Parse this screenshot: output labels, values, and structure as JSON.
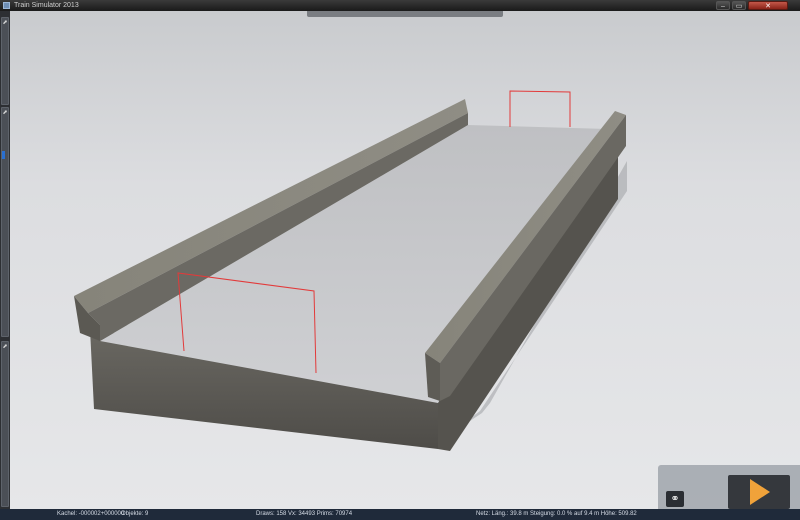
{
  "window": {
    "title": "Train Simulator 2013",
    "minimize_glyph": "–",
    "maximize_glyph": "▭",
    "close_glyph": "✕"
  },
  "left_panel": {
    "pin_glyph": "⬈"
  },
  "corner_widget": {
    "link_icon": "link-icon",
    "link_glyph": "⚭",
    "play_icon": "play-icon",
    "accent_color": "#f0a23a"
  },
  "status": {
    "kachel": "Kachel: -000002+000000",
    "objekte": "Objekte: 9",
    "draws": "Draws: 158 Vx: 34493 Prims: 70974",
    "netz": "Netz: Läng.:  39.8 m Steigung:  0.0 % auf  9.4 m Höhe: 509.82"
  },
  "colors": {
    "ground": "#dfe0e2",
    "concrete_top": "#7f7d73",
    "concrete_side": "#5d5b55",
    "slab": "#c9cacd",
    "marker_red": "#e23a3a",
    "statusbar_bg": "#1f2a3a"
  }
}
